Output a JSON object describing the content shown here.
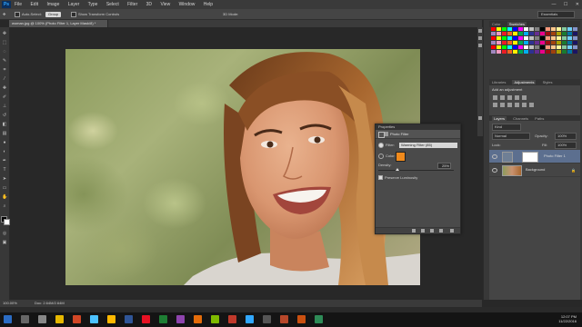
{
  "app": {
    "logo": "Ps"
  },
  "menu": [
    "File",
    "Edit",
    "Image",
    "Layer",
    "Type",
    "Select",
    "Filter",
    "3D",
    "View",
    "Window",
    "Help"
  ],
  "window_controls": [
    "—",
    "☐",
    "✕"
  ],
  "options_bar": {
    "auto_select_label": "Auto-Select:",
    "auto_select_value": "Group",
    "show_transform_label": "Show Transform Controls",
    "mode_label": "3D Mode:",
    "workspace": "Essentials"
  },
  "document_tab": {
    "title": "woman.jpg @ 100% (Photo Filter 1, Layer Mask/8) *"
  },
  "properties": {
    "panel_title": "Properties",
    "header": "Photo Filter",
    "filter_label": "Filter:",
    "filter_value": "Warming Filter (85)",
    "color_label": "Color:",
    "color_hex": "#f08a1c",
    "density_label": "Density:",
    "density_value": "25",
    "density_unit": "%",
    "density_fraction": 0.25,
    "preserve_label": "Preserve Luminosity"
  },
  "panels": {
    "top_tabs": [
      "Color",
      "Swatches"
    ],
    "adjust_tabs": [
      "Libraries",
      "Adjustments",
      "Styles"
    ],
    "adjust_label": "Add an adjustment",
    "layers_tabs": [
      "Layers",
      "Channels",
      "Paths"
    ],
    "kind_label": "Kind",
    "blend_mode": "Normal",
    "opacity_label": "Opacity:",
    "opacity_value": "100%",
    "lock_label": "Lock:",
    "fill_label": "Fill:",
    "fill_value": "100%",
    "layer_items": [
      {
        "name": "Photo Filter 1"
      },
      {
        "name": "Background"
      }
    ]
  },
  "status": {
    "zoom": "100.00%",
    "doc": "Doc: 2.64M/2.64M"
  },
  "taskbar": {
    "time": "12:07 PM",
    "date": "11/22/2016"
  },
  "swatch_colors": [
    "#ff0000",
    "#ffff00",
    "#00ff00",
    "#00ffff",
    "#0000ff",
    "#ff00ff",
    "#ffffff",
    "#c0c0c0",
    "#808080",
    "#000000",
    "#f7977a",
    "#fdc68a",
    "#fff79a",
    "#82ca9d",
    "#6ecff6",
    "#8493ca",
    "#a187be",
    "#f49ac2",
    "#ed1c24",
    "#f26522",
    "#fff200",
    "#00a651",
    "#00aeef",
    "#2e3192",
    "#662d91",
    "#ec008c",
    "#9e0b0f",
    "#a0410d",
    "#aba000",
    "#197b30",
    "#0076a3",
    "#1b1464"
  ],
  "taskbar_colors": [
    "#2b6cc4",
    "#666",
    "#888",
    "#e6b800",
    "#d24726",
    "#4cc2ff",
    "#ffb900",
    "#2f5597",
    "#e81123",
    "#1e7e34",
    "#8e44ad",
    "#e46c0a",
    "#7fba00",
    "#c0392b",
    "#31a8ff",
    "#555",
    "#b7472a",
    "#ca5010",
    "#2e8b57"
  ]
}
